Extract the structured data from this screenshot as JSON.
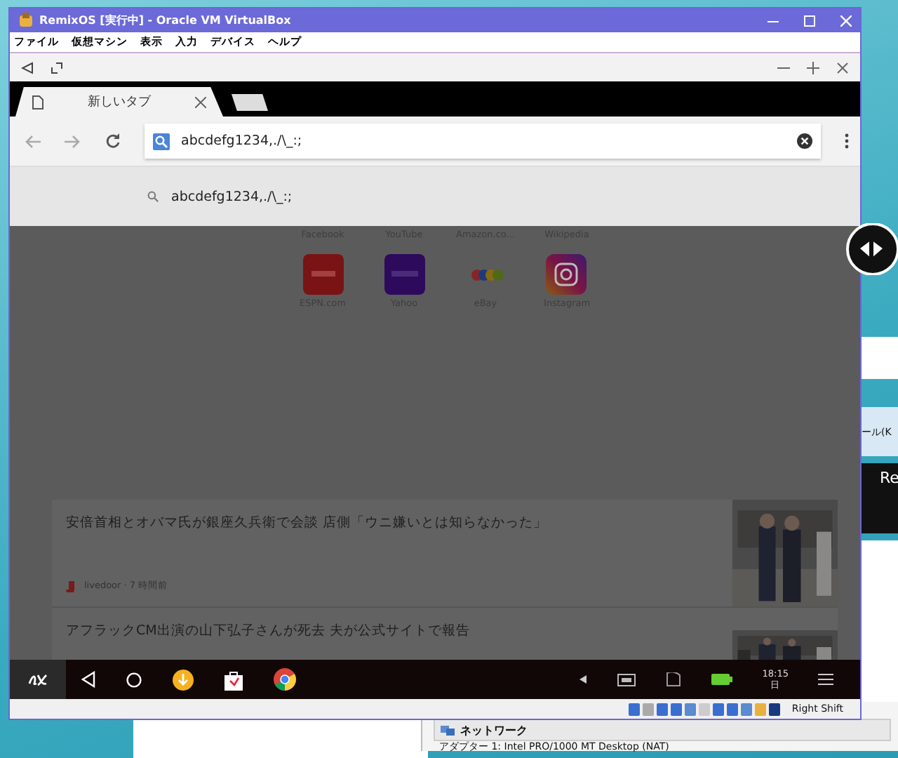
{
  "window": {
    "title": "RemixOS [実行中] - Oracle VM VirtualBox"
  },
  "menu": [
    "ファイル",
    "仮想マシン",
    "表示",
    "入力",
    "デバイス",
    "ヘルプ"
  ],
  "browser": {
    "tabs": [
      {
        "label": "新しいタブ",
        "selected": true
      }
    ],
    "address": {
      "value": "abcdefg1234,./\\_:;"
    },
    "suggestions": [
      "abcdefg1234,./\\_:;"
    ],
    "top_sites_row_1": [
      "Facebook",
      "YouTube",
      "Amazon.co...",
      "Wikipedia"
    ],
    "top_sites": [
      {
        "label": "ESPN.com",
        "kind": "espn"
      },
      {
        "label": "Yahoo",
        "kind": "yahoo"
      },
      {
        "label": "eBay",
        "kind": "ebay"
      },
      {
        "label": "Instagram",
        "kind": "instagram"
      }
    ],
    "news": [
      {
        "headline": "安倍首相とオバマ氏が銀座久兵衛で会談 店側「ウニ嫌いとは知らなかった」",
        "source": "livedoor · 7 時間前"
      },
      {
        "headline": "アフラックCM出演の山下弘子さんが死去 夫が公式サイトで報告"
      }
    ]
  },
  "taskbar": {
    "clock": "18:15",
    "day": "日"
  },
  "status_bar": {
    "host_key": "Right Shift"
  },
  "background": {
    "section": "ネットワーク",
    "adapter": "アダプター 1:  Intel PRO/1000 MT Desktop (NAT)",
    "fragments": [
      "ール(K",
      "Re"
    ]
  }
}
